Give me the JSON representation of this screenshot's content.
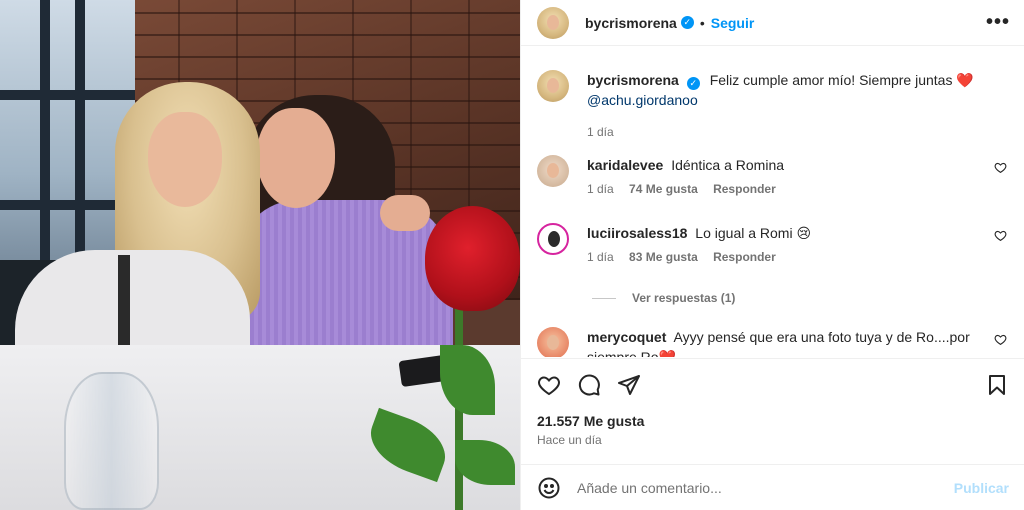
{
  "post": {
    "author": "bycrismorena",
    "follow_label": "Seguir",
    "separator": "•",
    "more_label": "•••",
    "verified_glyph": "✓",
    "photo_alt": "Dos mujeres sonriendo en un restaurante con una rosa roja"
  },
  "caption": {
    "username": "bycrismorena",
    "text": "Feliz cumple amor mío! Siempre juntas",
    "emoji": "❤️",
    "mention": "@achu.giordanoo",
    "time": "1 día"
  },
  "comments": [
    {
      "username": "karidalevee",
      "text": "Idéntica a Romina",
      "time": "1 día",
      "likes": "74 Me gusta",
      "reply": "Responder"
    },
    {
      "username": "luciirosaless18",
      "text": "Lo igual a Romi",
      "emoji": "😢",
      "time": "1 día",
      "likes": "83 Me gusta",
      "reply": "Responder"
    },
    {
      "username": "merycoquet",
      "text": "Ayyy pensé que era una foto tuya y de Ro....por siempre Ro❤️"
    }
  ],
  "view_replies": "Ver respuestas (1)",
  "stats": {
    "likes": "21.557 Me gusta",
    "posted": "Hace un día"
  },
  "composer": {
    "placeholder": "Añade un comentario...",
    "publish_label": "Publicar"
  },
  "colors": {
    "accent": "#0095f6",
    "muted": "#737373",
    "heart": "#ed4956"
  },
  "icons": [
    "verified-icon",
    "more-icon",
    "heart-icon",
    "comment-icon",
    "share-icon",
    "bookmark-icon",
    "emoji-icon"
  ]
}
